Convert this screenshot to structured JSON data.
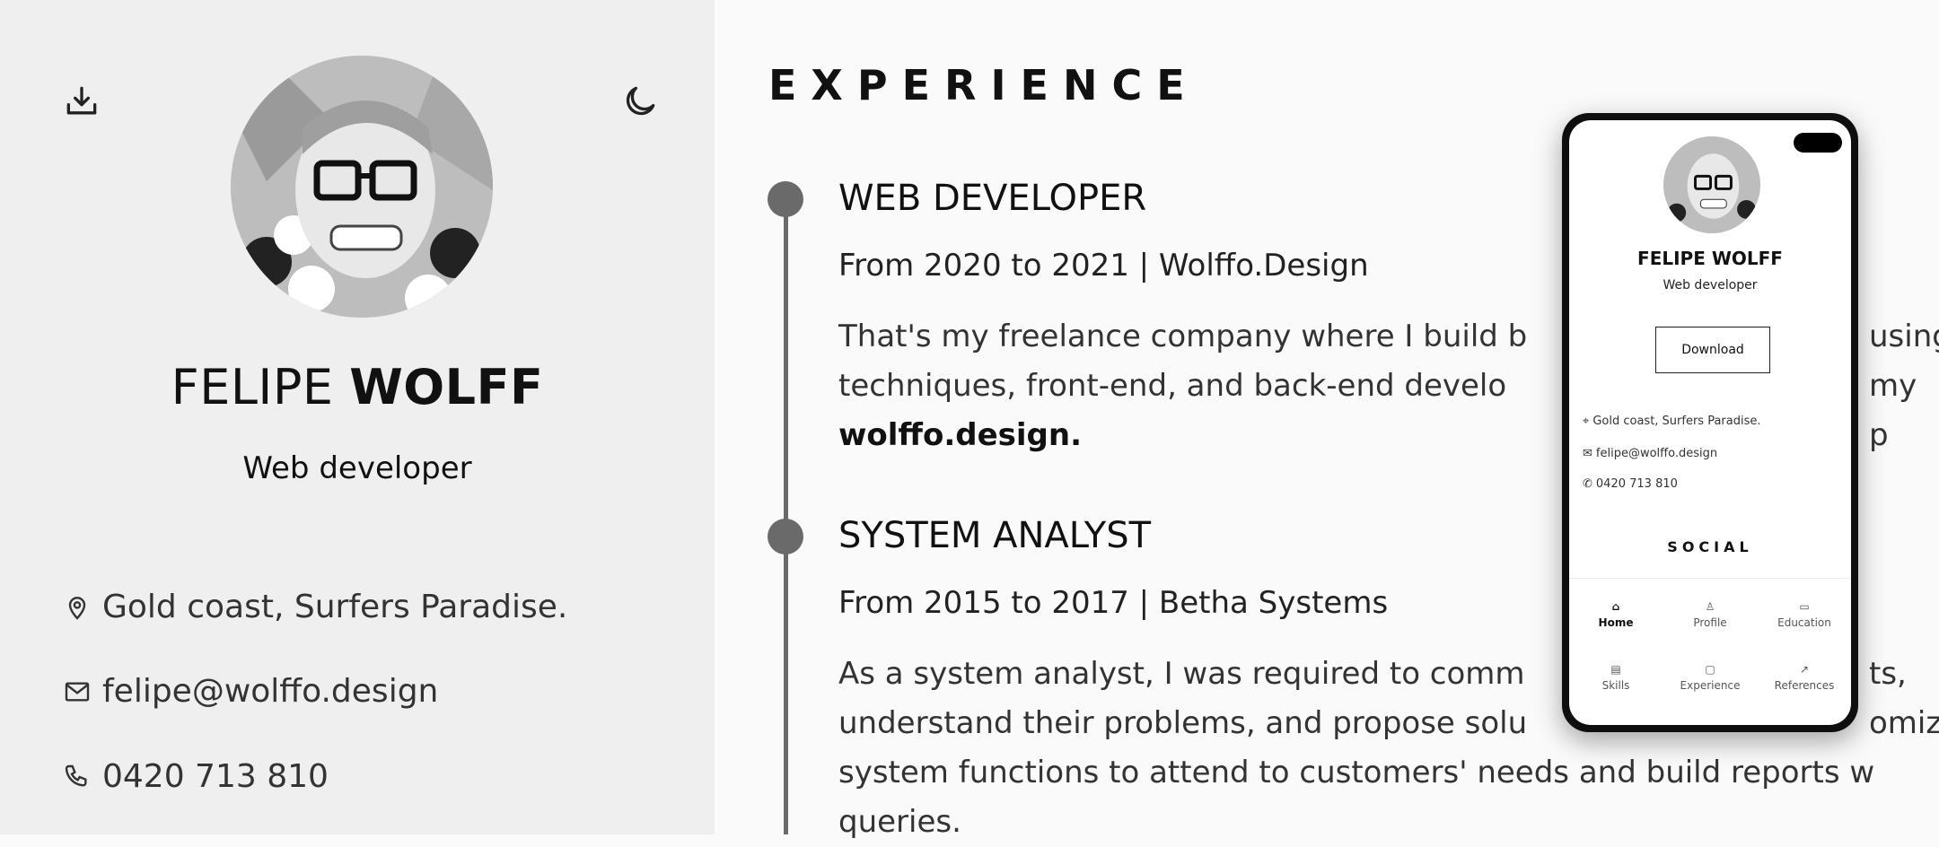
{
  "sidebar": {
    "name_first": "FELIPE",
    "name_last": "WOLFF",
    "role": "Web developer",
    "location": "Gold coast, Surfers Paradise.",
    "email": "felipe@wolffo.design",
    "phone": "0420 713 810",
    "icons": [
      "download-icon",
      "moon-icon",
      "location-pin-icon",
      "mail-icon",
      "phone-icon"
    ]
  },
  "main": {
    "section_title": "EXPERIENCE",
    "jobs": [
      {
        "title": "WEB DEVELOPER",
        "meta": "From 2020 to 2021 | Wolffo.Design",
        "desc_lines": [
          "That's my freelance company where I build b",
          "techniques, front-end, and back-end develo"
        ],
        "desc_tail_right_1": "using",
        "desc_tail_right_2": "my p",
        "desc_link": "wolffo.design."
      },
      {
        "title": "SYSTEM ANALYST",
        "meta": "From 2015 to 2017 | Betha Systems",
        "desc_lines": [
          "As a system analyst, I was required to comm",
          "understand their problems, and propose solu",
          "system functions to attend to customers' needs and build reports w",
          "queries."
        ],
        "desc_tail_right_1": "ts,",
        "desc_tail_right_2": "omized"
      }
    ]
  },
  "phone": {
    "name": "FELIPE WOLFF",
    "role": "Web developer",
    "download_label": "Download",
    "location": "Gold coast, Surfers Paradise.",
    "email": "felipe@wolffo.design",
    "phone": "0420 713 810",
    "social_title": "SOCIAL",
    "nav": [
      {
        "label": "Home",
        "icon": "home-icon",
        "active": true
      },
      {
        "label": "Profile",
        "icon": "user-icon"
      },
      {
        "label": "Education",
        "icon": "book-icon"
      },
      {
        "label": "Skills",
        "icon": "skills-icon"
      },
      {
        "label": "Experience",
        "icon": "briefcase-icon"
      },
      {
        "label": "References",
        "icon": "external-link-icon"
      }
    ]
  },
  "colors": {
    "sidebar_bg": "#efefef",
    "main_bg": "#fafafa",
    "timeline": "#6a6a6a",
    "text": "#111111"
  }
}
